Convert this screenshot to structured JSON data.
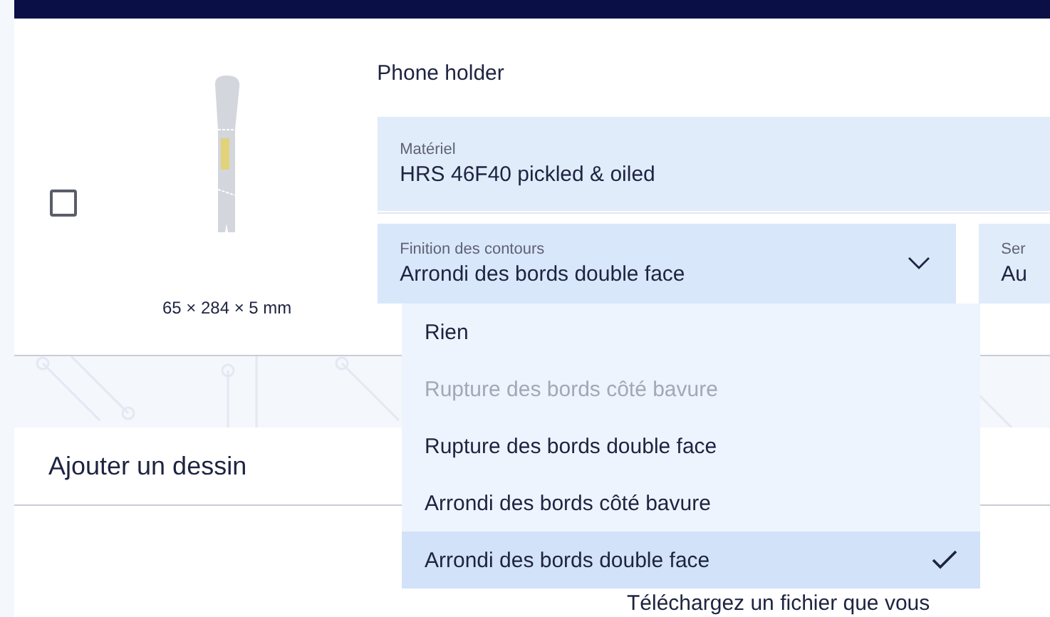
{
  "product": {
    "checked": false,
    "dimensions": "65 × 284 × 5 mm",
    "name": "Phone holder"
  },
  "material": {
    "label": "Matériel",
    "value": "HRS 46F40 pickled & oiled"
  },
  "selects": [
    {
      "label": "Finition des contours",
      "value": "Arrondi des bords double face",
      "expanded": true,
      "options": [
        {
          "label": "Rien",
          "disabled": false,
          "selected": false
        },
        {
          "label": "Rupture des bords côté bavure",
          "disabled": true,
          "selected": false
        },
        {
          "label": "Rupture des bords double face",
          "disabled": false,
          "selected": false
        },
        {
          "label": "Arrondi des bords côté bavure",
          "disabled": false,
          "selected": false
        },
        {
          "label": "Arrondi des bords double face",
          "disabled": false,
          "selected": true
        }
      ]
    },
    {
      "label": "Ser",
      "value": "Au"
    }
  ],
  "drawing_section": {
    "title": "Ajouter un dessin",
    "description": "Téléchargez un fichier que vous"
  }
}
